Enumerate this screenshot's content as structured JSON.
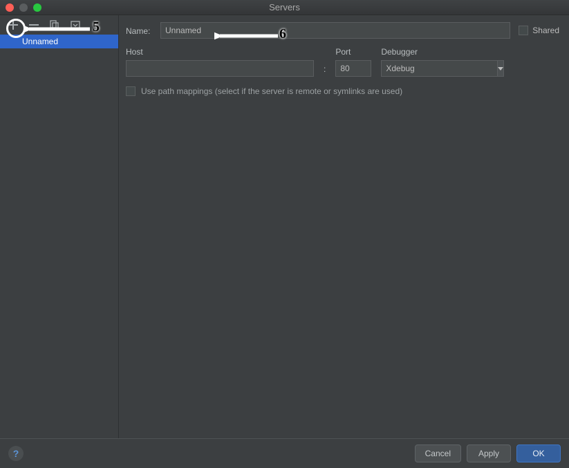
{
  "window": {
    "title": "Servers"
  },
  "sidebar": {
    "items": [
      {
        "label": "Unnamed"
      }
    ]
  },
  "form": {
    "name_label": "Name:",
    "name_value": "Unnamed",
    "shared_label": "Shared",
    "host_label": "Host",
    "host_value": "",
    "port_label": "Port",
    "port_value": "80",
    "debugger_label": "Debugger",
    "debugger_value": "Xdebug",
    "path_mappings_label": "Use path mappings (select if the server is remote or symlinks are used)"
  },
  "footer": {
    "cancel": "Cancel",
    "apply": "Apply",
    "ok": "OK"
  },
  "annotations": {
    "step5": "5",
    "step6": "6"
  }
}
